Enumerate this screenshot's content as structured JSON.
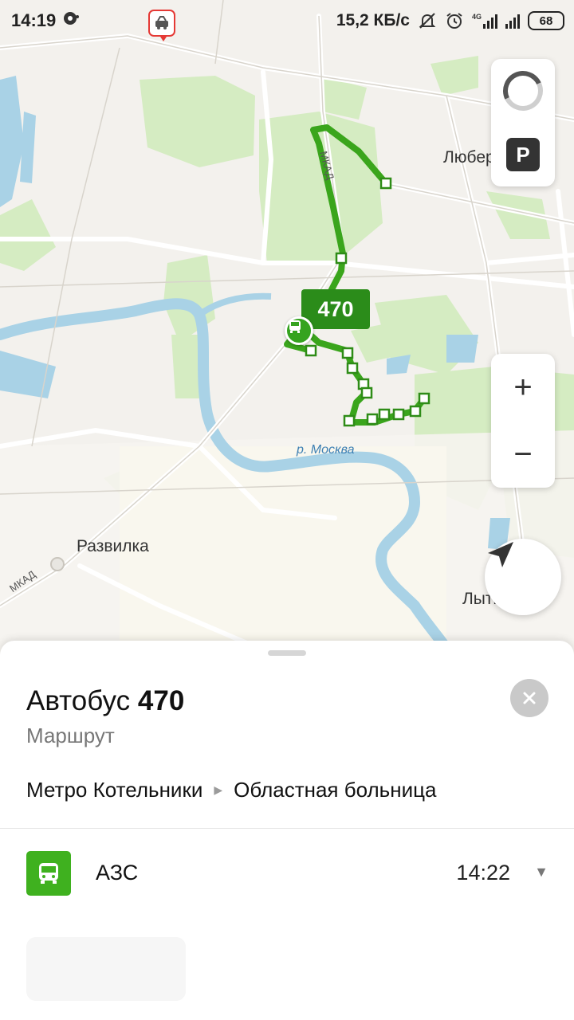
{
  "status_bar": {
    "time": "14:19",
    "net_speed": "15,2 КБ/с",
    "network_type": "4G",
    "battery": "68"
  },
  "map": {
    "labels": {
      "lyubertsy": "Люберцы",
      "razvilka": "Развилка",
      "lytkarino": "Лыткарино",
      "river_moskva": "р. Москва",
      "mkad_north": "МКАД",
      "mkad_south": "МКАД"
    },
    "route_badge": "470",
    "parking_label": "P",
    "zoom_in": "+",
    "zoom_out": "−",
    "colors": {
      "route": "#3aa51c",
      "badge": "#2b8c1a",
      "water": "#a9d2e6",
      "park": "#d5ecc2"
    }
  },
  "sheet": {
    "title_prefix": "Автобус",
    "title_number": "470",
    "subtitle": "Маршрут",
    "from": "Метро Котельники",
    "to": "Областная больница",
    "stop": {
      "name": "АЗС",
      "time": "14:22",
      "icon": "bus-icon"
    }
  }
}
